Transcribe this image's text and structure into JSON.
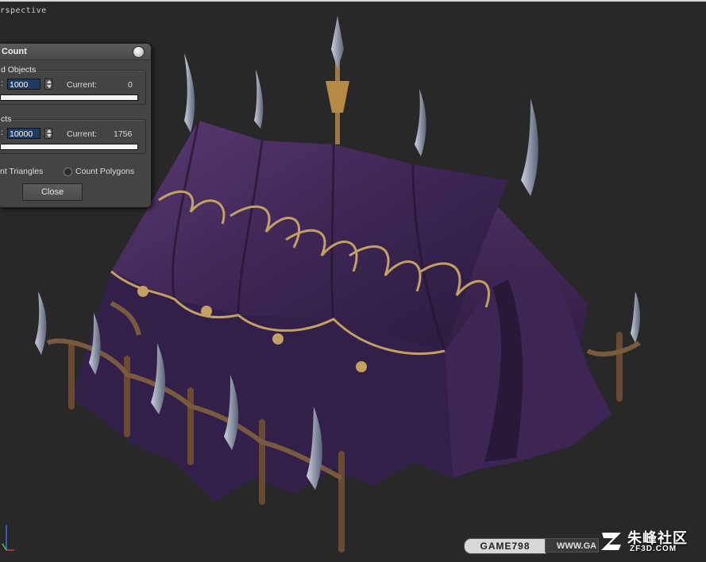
{
  "viewport": {
    "label": "rspective"
  },
  "dialog": {
    "title": "Count",
    "group1": {
      "label": "d Objects",
      "field_prefix": ":",
      "value": "1000",
      "current_label": "Current:",
      "current_value": "0"
    },
    "group2": {
      "label": "cts",
      "field_prefix": ":",
      "value": "10000",
      "current_label": "Current:",
      "current_value": "1756"
    },
    "radio_triangles": "nt Triangles",
    "radio_polygons": "Count Polygons",
    "close_label": "Close"
  },
  "watermark": {
    "game": "GAME798",
    "url": "WWW.GA",
    "brand_cn": "朱峰社区",
    "brand_en": "ZF3D.COM"
  },
  "colors": {
    "tent": "#3a2450",
    "gold": "#b8955a",
    "wood": "#6b4a33",
    "blade": "#9aa3b8"
  }
}
